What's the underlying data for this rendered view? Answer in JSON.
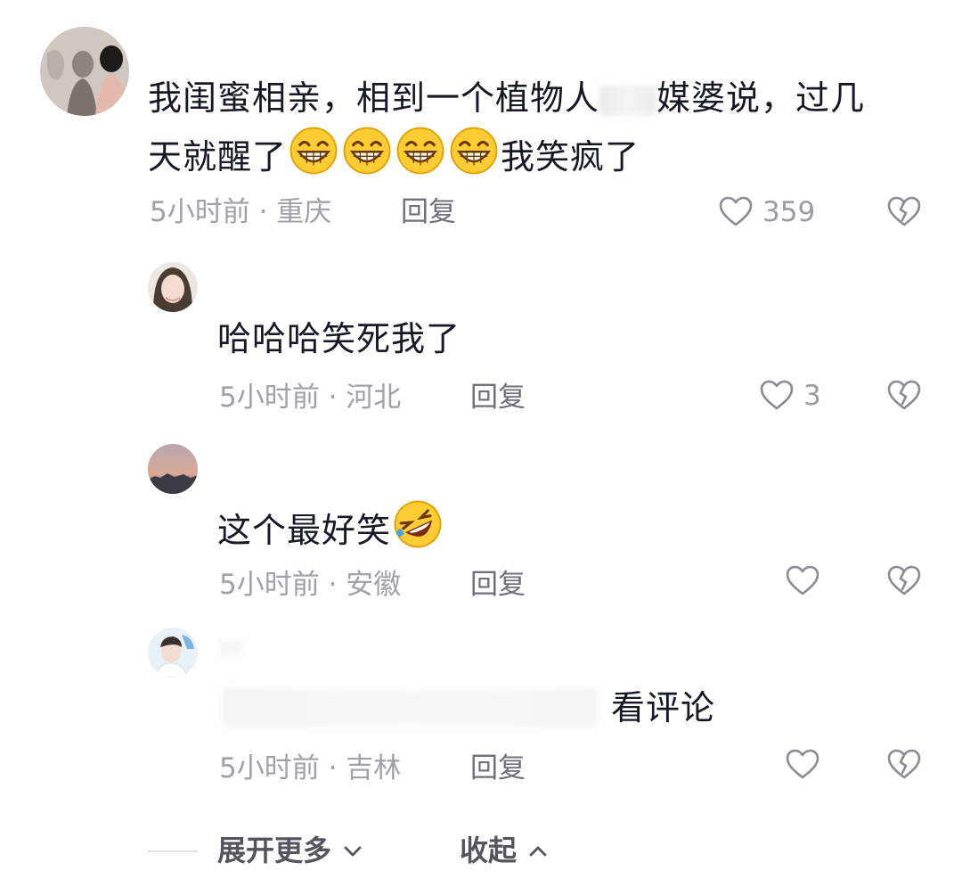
{
  "comments": [
    {
      "text_a": "我闺蜜相亲，相到一个植物人",
      "text_b": "媒婆说，过几",
      "text_c": "天就醒了",
      "text_d": "我笑疯了",
      "time_location": "5小时前 · 重庆",
      "reply_label": "回复",
      "like_count": "359"
    },
    {
      "text": "哈哈哈笑死我了",
      "time_location": "5小时前 · 河北",
      "reply_label": "回复",
      "like_count": "3"
    },
    {
      "text": "这个最好笑",
      "time_location": "5小时前 · 安徽",
      "reply_label": "回复",
      "like_count": ""
    },
    {
      "text": "看评论",
      "time_location": "5小时前 · 吉林",
      "reply_label": "回复",
      "like_count": ""
    }
  ],
  "footer": {
    "expand_label": "展开更多",
    "collapse_label": "收起"
  },
  "icons": {
    "like": "heart-outline-icon",
    "dislike": "broken-heart-icon",
    "grin": "grinning-emoji-icon",
    "rofl": "rolling-laughing-emoji-icon"
  },
  "colors": {
    "text": "#161823",
    "meta": "#a0a1a7",
    "reply": "#6f7079",
    "icon": "#9a9ba3"
  }
}
